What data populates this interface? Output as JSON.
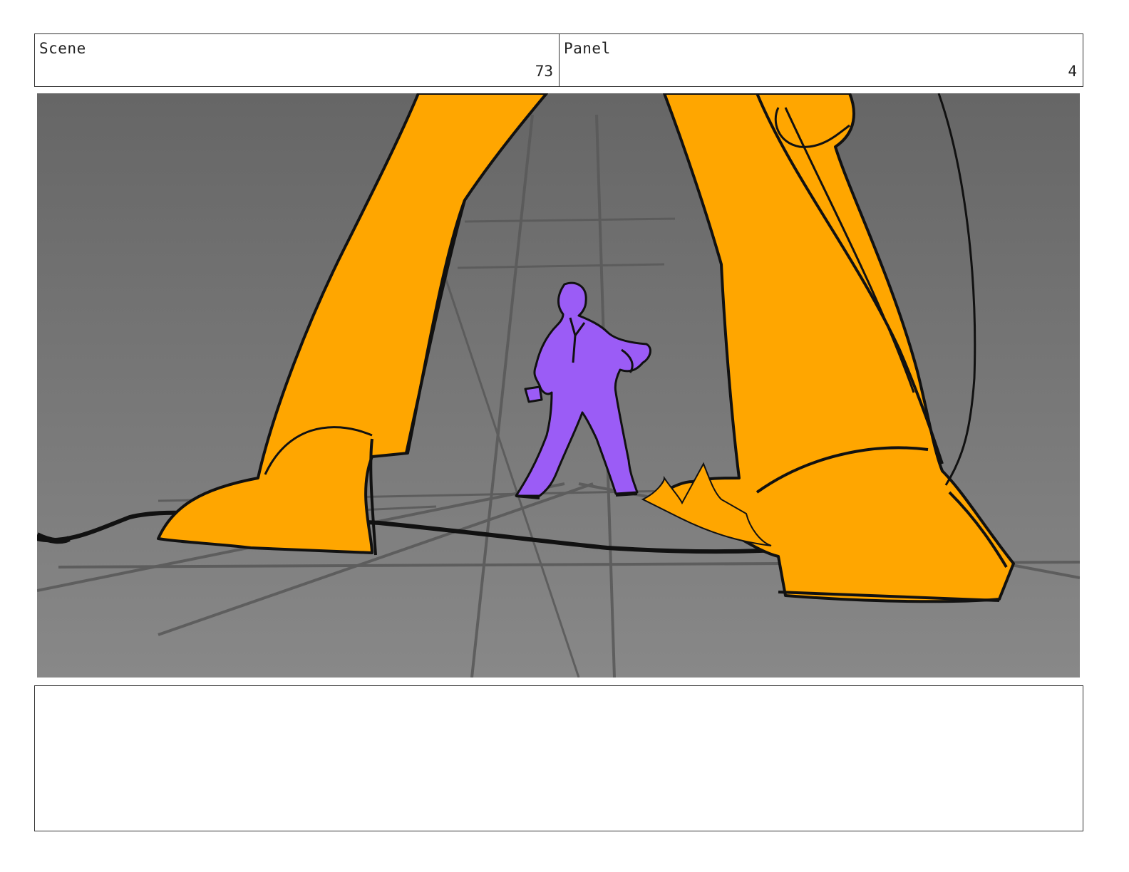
{
  "scene": {
    "label": "Scene",
    "number": "73"
  },
  "panel": {
    "label": "Panel",
    "number": "4"
  },
  "artwork": {
    "colors": {
      "background_top": "#666666",
      "background_bottom": "#888888",
      "giant": "#FFA600",
      "figure": "#9B5CF6",
      "ink": "#111111",
      "floor_lines": "#5a5a5a"
    }
  },
  "notes": {
    "text": ""
  }
}
